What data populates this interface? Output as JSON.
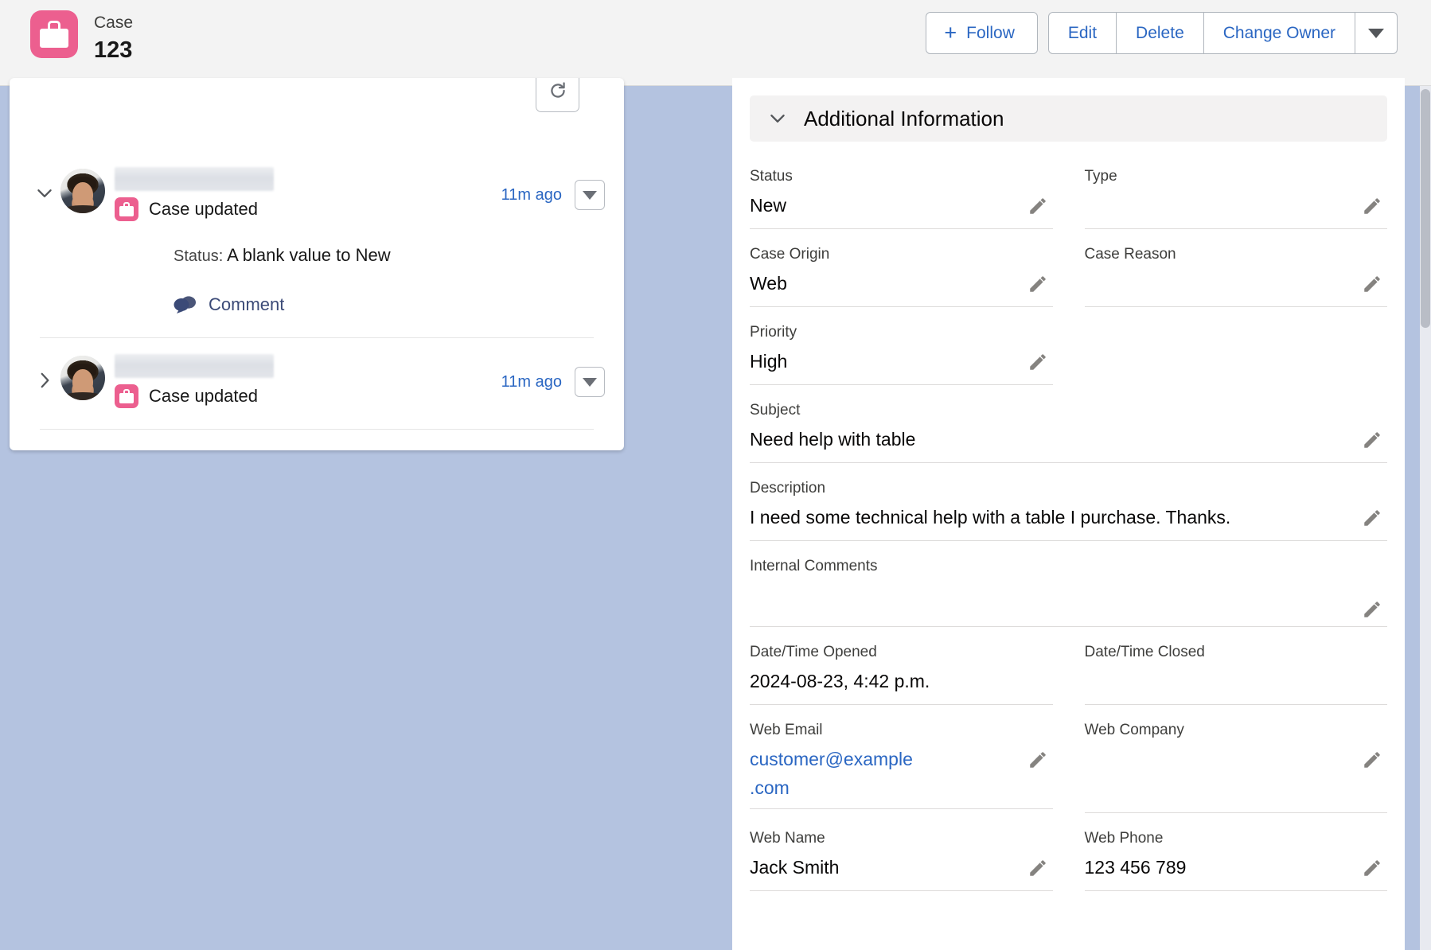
{
  "header": {
    "object_label": "Case",
    "record_number": "123",
    "case_icon": "briefcase-icon",
    "accent_pink": "#ec5f8f",
    "link_blue": "#2a66c2",
    "actions": {
      "follow": "Follow",
      "follow_icon": "plus-icon",
      "edit": "Edit",
      "delete": "Delete",
      "change_owner": "Change Owner",
      "more_icon": "chevron-down-icon"
    }
  },
  "feed": {
    "refresh_icon": "refresh-icon",
    "items": [
      {
        "expand_icon": "chevron-down-icon",
        "avatar": "user-avatar",
        "author": "",
        "author_redacted": true,
        "activity_icon": "case-icon",
        "activity": "Case updated",
        "timestamp": "11m ago",
        "menu_icon": "chevron-down-icon",
        "change_label": "Status:",
        "change_value": "A blank value to New",
        "comment_label": "Comment",
        "comment_icon": "speech-bubble-icon"
      },
      {
        "expand_icon": "chevron-right-icon",
        "avatar": "user-avatar",
        "author": "",
        "author_redacted": true,
        "activity_icon": "case-icon",
        "activity": "Case updated",
        "timestamp": "11m ago",
        "menu_icon": "chevron-down-icon"
      }
    ]
  },
  "detail": {
    "section_title": "Additional Information",
    "collapse_icon": "chevron-down-icon",
    "edit_icon": "pencil-icon",
    "rows": [
      {
        "left": {
          "label": "Status",
          "value": "New",
          "editable": true
        },
        "right": {
          "label": "Type",
          "value": "",
          "editable": true
        }
      },
      {
        "left": {
          "label": "Case Origin",
          "value": "Web",
          "editable": true
        },
        "right": {
          "label": "Case Reason",
          "value": "",
          "editable": true
        }
      },
      {
        "left": {
          "label": "Priority",
          "value": "High",
          "editable": true
        },
        "right": null
      }
    ],
    "subject": {
      "label": "Subject",
      "value": "Need help with table",
      "editable": true
    },
    "description": {
      "label": "Description",
      "value": "I need some technical help with a table I purchase. Thanks.",
      "editable": true
    },
    "internal_comments": {
      "label": "Internal Comments",
      "value": "",
      "editable": true
    },
    "rows2": [
      {
        "left": {
          "label": "Date/Time Opened",
          "value": "2024-08-23, 4:42 p.m.",
          "editable": false
        },
        "right": {
          "label": "Date/Time Closed",
          "value": "",
          "editable": false
        }
      },
      {
        "left": {
          "label": "Web Email",
          "value": "customer@example.com",
          "editable": true,
          "is_link": true
        },
        "right": {
          "label": "Web Company",
          "value": "",
          "editable": true
        }
      },
      {
        "left": {
          "label": "Web Name",
          "value": "Jack Smith",
          "editable": true
        },
        "right": {
          "label": "Web Phone",
          "value": "123 456 789",
          "editable": true
        }
      }
    ]
  }
}
